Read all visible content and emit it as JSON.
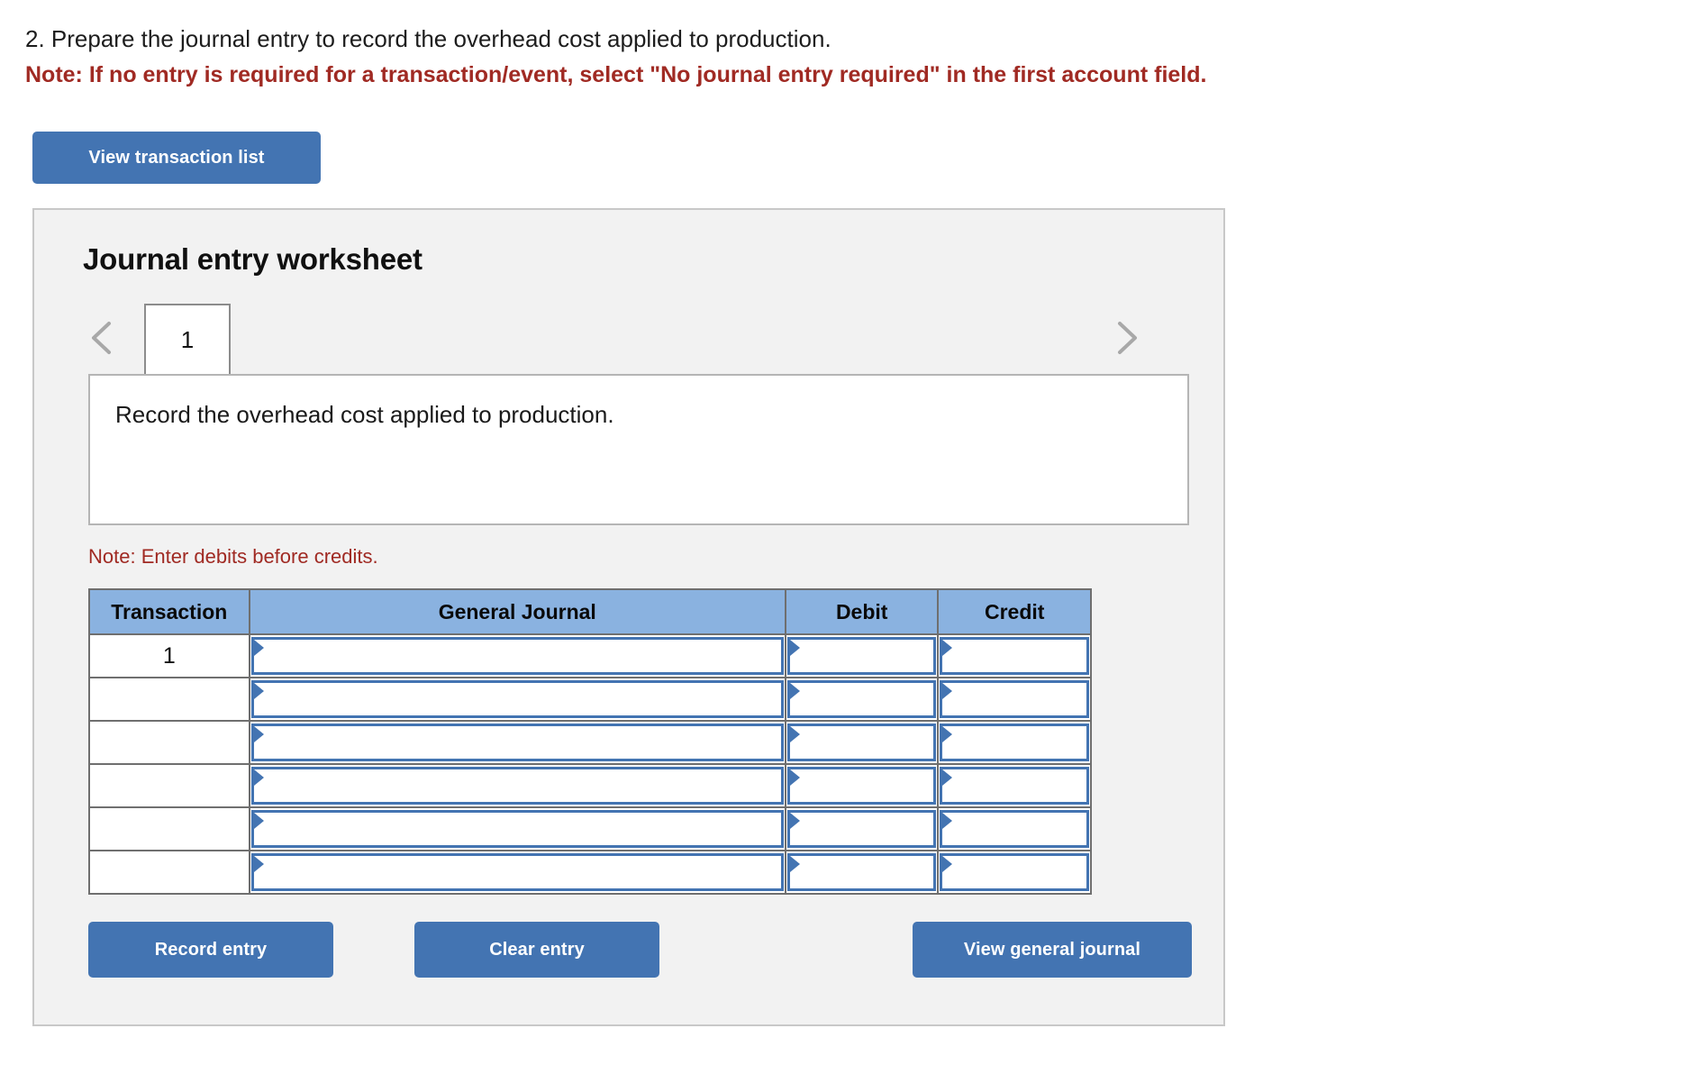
{
  "question": {
    "prompt": "2. Prepare the journal entry to record the overhead cost applied to production.",
    "note": "Note: If no entry is required for a transaction/event, select \"No journal entry required\" in the first account field."
  },
  "toolbar": {
    "view_transaction_list_label": "View transaction list"
  },
  "worksheet": {
    "title": "Journal entry worksheet",
    "prev_icon": "chevron-left-icon",
    "next_icon": "chevron-right-icon",
    "tabs": [
      {
        "label": "1",
        "active": true
      }
    ],
    "description": "Record the overhead cost applied to production.",
    "debits_note": "Note: Enter debits before credits."
  },
  "table": {
    "headers": [
      "Transaction",
      "General Journal",
      "Debit",
      "Credit"
    ],
    "rows": [
      {
        "transaction": "1",
        "general_journal": "",
        "debit": "",
        "credit": ""
      },
      {
        "transaction": "",
        "general_journal": "",
        "debit": "",
        "credit": ""
      },
      {
        "transaction": "",
        "general_journal": "",
        "debit": "",
        "credit": ""
      },
      {
        "transaction": "",
        "general_journal": "",
        "debit": "",
        "credit": ""
      },
      {
        "transaction": "",
        "general_journal": "",
        "debit": "",
        "credit": ""
      },
      {
        "transaction": "",
        "general_journal": "",
        "debit": "",
        "credit": ""
      }
    ]
  },
  "actions": {
    "record_entry_label": "Record entry",
    "clear_entry_label": "Clear entry",
    "view_general_journal_label": "View general journal"
  },
  "colors": {
    "button_blue": "#4374b2",
    "header_blue": "#8ab2e0",
    "note_red": "#a02a23",
    "panel_gray": "#f2f2f2"
  }
}
